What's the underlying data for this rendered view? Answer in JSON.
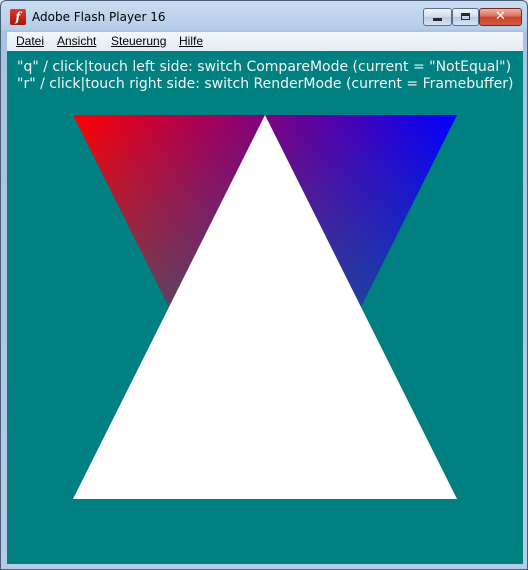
{
  "window": {
    "title": "Adobe Flash Player 16",
    "app_icon_glyph": "f",
    "close_glyph": "✕"
  },
  "menu": {
    "items": [
      "Datei",
      "Ansicht",
      "Steuerung",
      "Hilfe"
    ]
  },
  "stage": {
    "background": "#008080",
    "info_lines": [
      "\"q\" / click|touch left side: switch CompareMode (current = \"NotEqual\")",
      "\"r\" / click|touch right side: switch RenderMode (current = Framebuffer)"
    ],
    "colors": {
      "gradient_left": "#ff0000",
      "gradient_right": "#0000ff",
      "gradient_bottom": "#008080",
      "front_triangle": "#ffffff"
    }
  }
}
